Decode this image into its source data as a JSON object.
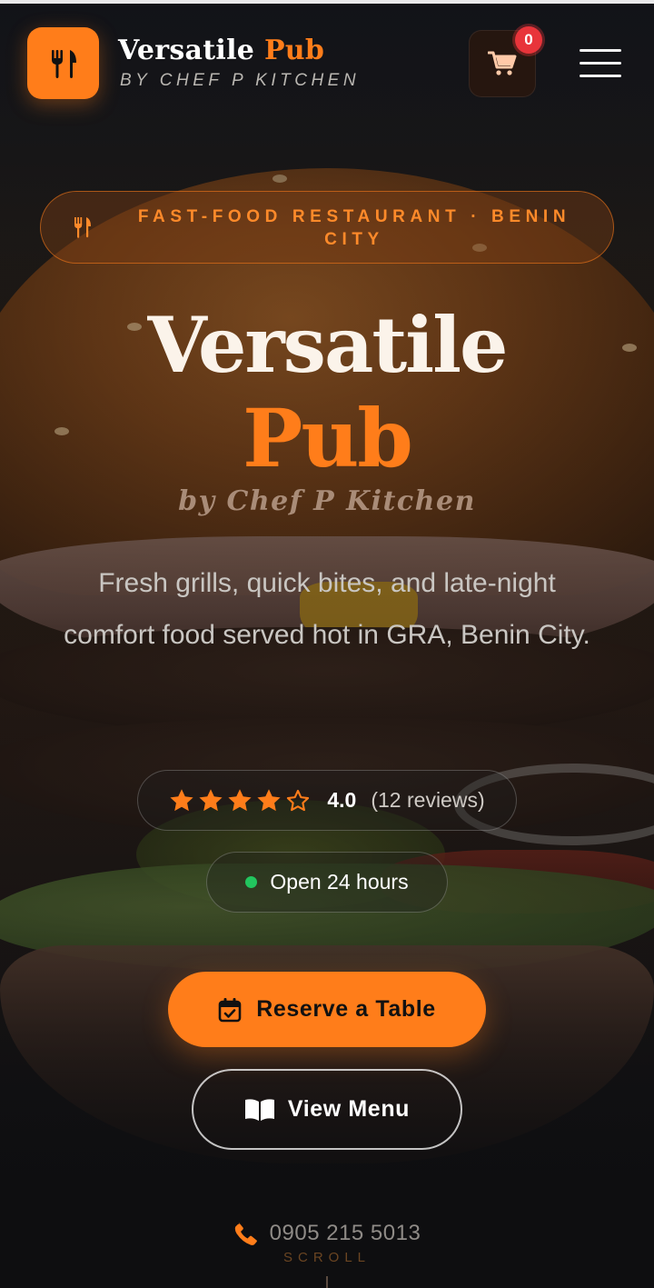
{
  "header": {
    "brand_name_1": "Versatile",
    "brand_name_2": "Pub",
    "brand_tagline": "BY CHEF P KITCHEN",
    "cart_count": "0",
    "logo_icon": "fork-knife-icon",
    "cart_icon": "shopping-cart-icon",
    "menu_icon": "hamburger-menu-icon"
  },
  "hero": {
    "category": "FAST-FOOD RESTAURANT · BENIN CITY",
    "title_line_1": "Versatile",
    "title_line_2": "Pub",
    "subtitle": "by Chef P Kitchen",
    "description": "Fresh grills, quick bites, and late-night comfort food served hot in GRA, Benin City.",
    "rating": {
      "stars_filled": 4,
      "stars_total": 5,
      "value": "4.0",
      "count_label": "(12 reviews)"
    },
    "status": "Open 24 hours",
    "reserve_label": "Reserve a Table",
    "menu_label": "View Menu",
    "phone": "0905 215 5013",
    "scroll_label": "SCROLL"
  },
  "colors": {
    "accent": "#ff7d1a",
    "background": "#0f1013",
    "status_open": "#22c55e",
    "badge": "#e8343a"
  }
}
